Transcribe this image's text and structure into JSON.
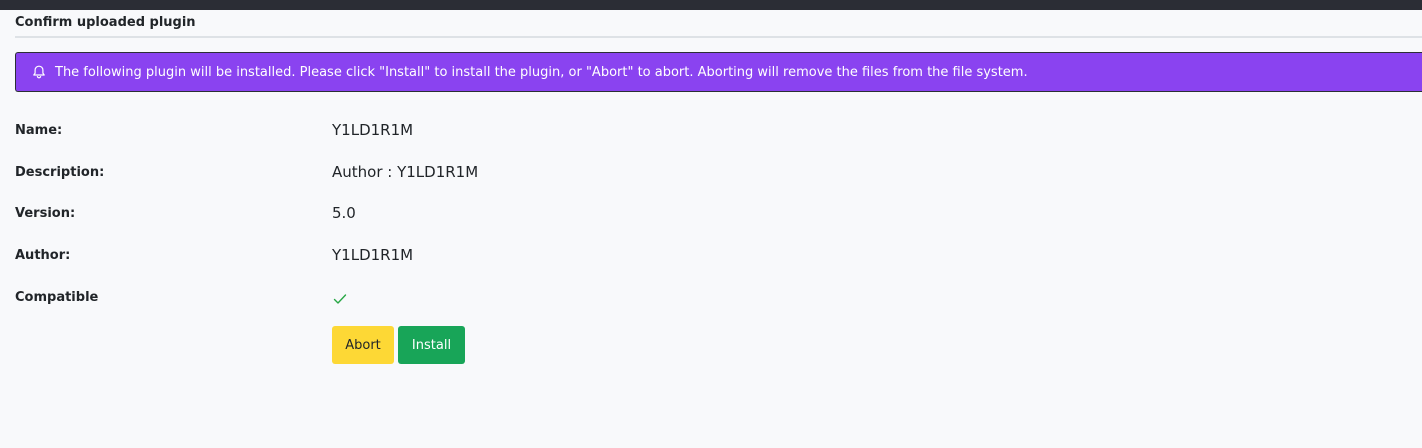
{
  "page": {
    "title": "Confirm uploaded plugin"
  },
  "alert": {
    "icon": "bell-icon",
    "message": "The following plugin will be installed. Please click \"Install\" to install the plugin, or \"Abort\" to abort. Aborting will remove the files from the file system.",
    "background_color": "#8a43f0"
  },
  "plugin": {
    "name_label": "Name:",
    "name_value": "Y1LD1R1M",
    "description_label": "Description:",
    "description_value": "Author : Y1LD1R1M",
    "version_label": "Version:",
    "version_value": "5.0",
    "author_label": "Author:",
    "author_value": "Y1LD1R1M",
    "compatible_label": "Compatible",
    "compatible_icon": "check-icon",
    "compatible_color": "#28a745"
  },
  "actions": {
    "abort_label": "Abort",
    "abort_color": "#fdd835",
    "install_label": "Install",
    "install_color": "#18a558"
  }
}
